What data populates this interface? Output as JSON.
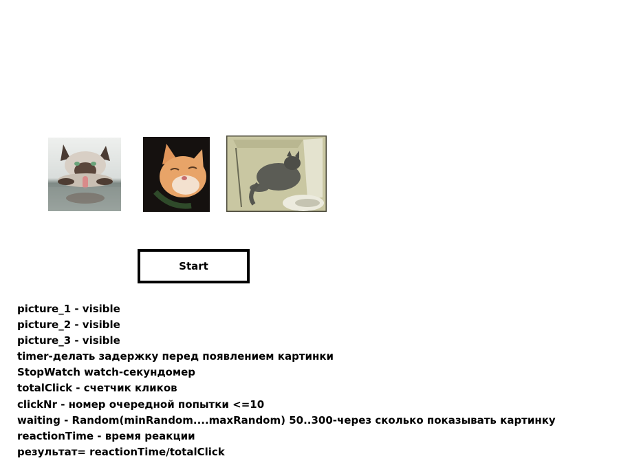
{
  "pictures": [
    {
      "name": "picture_1",
      "subject": "siamese-cat-drinking-water"
    },
    {
      "name": "picture_2",
      "subject": "ginger-cat-squinting"
    },
    {
      "name": "picture_3",
      "subject": "grey-cat-lying-by-window"
    }
  ],
  "start_button": {
    "label": "Start"
  },
  "notes": [
    "picture_1 - visible",
    "picture_2 - visible",
    "picture_3 - visible",
    "timer-делать задержку перед появлением картинки",
    "StopWatch watch-секундомер",
    "totalClick - счетчик кликов",
    "clickNr - номер очередной попытки <=10",
    "waiting - Random(minRandom....maxRandom) 50..300-через сколько показывать картинку",
    "reactionTime - время реакции",
    "результат= reactionTime/totalClick"
  ]
}
